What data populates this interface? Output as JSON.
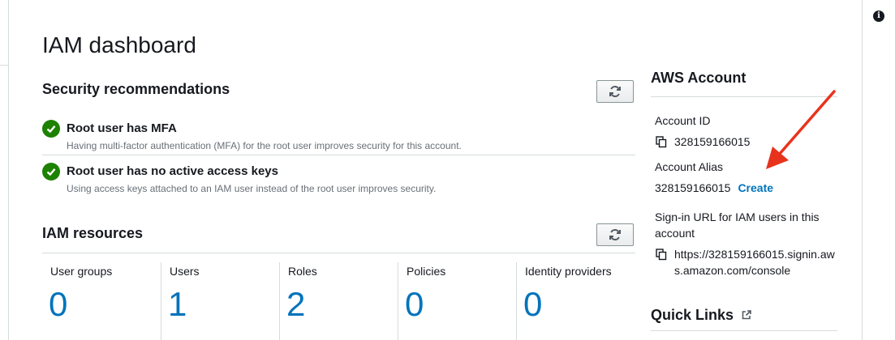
{
  "page": {
    "title": "IAM dashboard"
  },
  "security": {
    "title": "Security recommendations",
    "recommendations": [
      {
        "title": "Root user has MFA",
        "description": "Having multi-factor authentication (MFA) for the root user improves security for this account."
      },
      {
        "title": "Root user has no active access keys",
        "description": "Using access keys attached to an IAM user instead of the root user improves security."
      }
    ]
  },
  "resources": {
    "title": "IAM resources",
    "items": [
      {
        "label": "User groups",
        "value": "0"
      },
      {
        "label": "Users",
        "value": "1"
      },
      {
        "label": "Roles",
        "value": "2"
      },
      {
        "label": "Policies",
        "value": "0"
      },
      {
        "label": "Identity providers",
        "value": "0"
      }
    ]
  },
  "account": {
    "title": "AWS Account",
    "id_label": "Account ID",
    "id_value": "328159166015",
    "alias_label": "Account Alias",
    "alias_value": "328159166015",
    "create_link": "Create",
    "signin_label": "Sign-in URL for IAM users in this account",
    "signin_url": "https://328159166015.signin.aws.amazon.com/console"
  },
  "quick_links": {
    "title": "Quick Links"
  },
  "colors": {
    "link": "#0073bb",
    "success": "#1d8102",
    "annotation_arrow": "#e8331c"
  },
  "icons": [
    "info-icon",
    "refresh-icon",
    "check-circle-icon",
    "copy-icon",
    "external-link-icon"
  ]
}
